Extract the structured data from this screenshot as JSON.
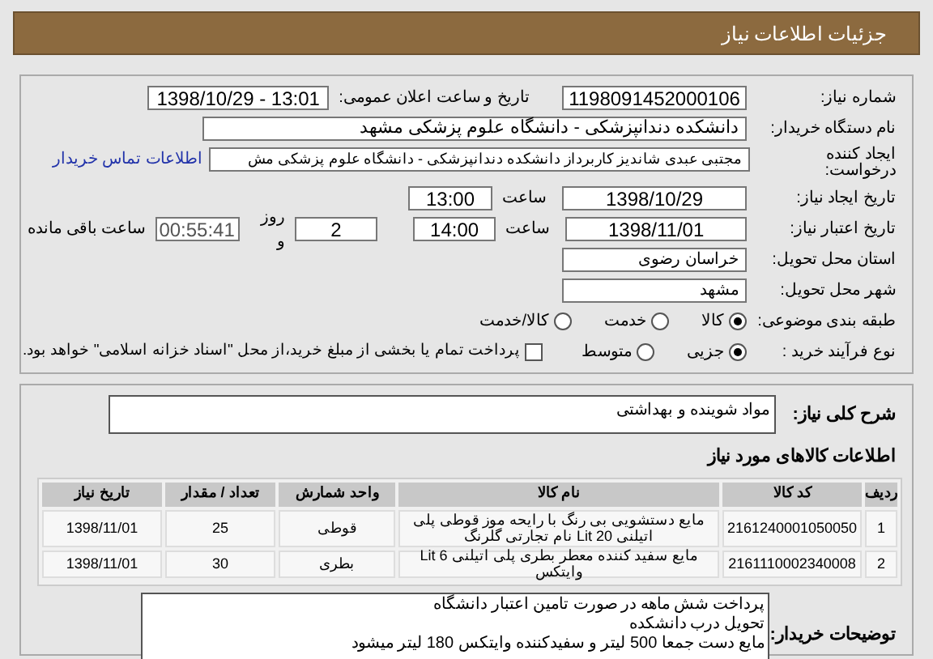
{
  "header": {
    "title": "جزئیات اطلاعات نیاز"
  },
  "need_number": {
    "label": "شماره نیاز:",
    "value": "1198091452000106"
  },
  "announce": {
    "label": "تاریخ و ساعت اعلان عمومی:",
    "value": "1398/10/29 - 13:01"
  },
  "buyer_org": {
    "label": "نام دستگاه خریدار:",
    "value": "دانشکده دندانپزشکی - دانشگاه علوم پزشکی مشهد"
  },
  "creator": {
    "label": "ایجاد کننده درخواست:",
    "value": "مجتبی عبدی شاندیز کاربرداز دانشکده دندانپزشکی - دانشگاه علوم پزشکی مش",
    "link": "اطلاعات تماس خریدار"
  },
  "created": {
    "label": "تاریخ ایجاد نیاز:",
    "date": "1398/10/29",
    "time_label": "ساعت",
    "time": "13:00"
  },
  "valid": {
    "label": "تاریخ اعتبار نیاز:",
    "date": "1398/11/01",
    "time_label": "ساعت",
    "time": "14:00",
    "days": "2",
    "days_label": "روز و",
    "remaining": "00:55:41",
    "remaining_label": "ساعت باقی مانده"
  },
  "province": {
    "label": "استان محل تحویل:",
    "value": "خراسان رضوی"
  },
  "city": {
    "label": "شهر محل تحویل:",
    "value": "مشهد"
  },
  "category": {
    "label": "طبقه بندی موضوعی:",
    "options": [
      {
        "label": "کالا",
        "selected": true
      },
      {
        "label": "خدمت",
        "selected": false
      },
      {
        "label": "کالا/خدمت",
        "selected": false
      }
    ]
  },
  "process": {
    "label": "نوع فرآیند خرید :",
    "options": [
      {
        "label": "جزیی",
        "selected": true
      },
      {
        "label": "متوسط",
        "selected": false
      }
    ],
    "treasury": {
      "label": "پرداخت تمام یا بخشی از مبلغ خرید،از محل \"اسناد خزانه اسلامی\" خواهد بود.",
      "checked": false
    }
  },
  "summary": {
    "label": "شرح کلی نیاز:",
    "value": "مواد شوینده و بهداشتی"
  },
  "goods": {
    "title": "اطلاعات کالاهای مورد نیاز",
    "columns": [
      "ردیف",
      "کد کالا",
      "نام کالا",
      "واحد شمارش",
      "تعداد / مقدار",
      "تاریخ نیاز"
    ],
    "rows": [
      [
        "1",
        "2161240001050050",
        "مایع دستشویی بی رنگ با رایحه موز قوطی پلی اتیلنی 20 Lit نام تجارتی گلرنگ",
        "قوطی",
        "25",
        "1398/11/01"
      ],
      [
        "2",
        "2161110002340008",
        "مایع سفید کننده معطر بطری پلی اتیلنی 6 Lit وایتکس",
        "بطری",
        "30",
        "1398/11/01"
      ]
    ]
  },
  "notes": {
    "label": "توضیحات خریدار:",
    "lines": [
      "پرداخت شش ماهه در صورت تامین اعتبار دانشگاه",
      "تحویل درب دانشکده",
      "مایع دست جمعا 500 لیتر و سفیدکننده وایتکس 180 لیتر میشود"
    ]
  }
}
